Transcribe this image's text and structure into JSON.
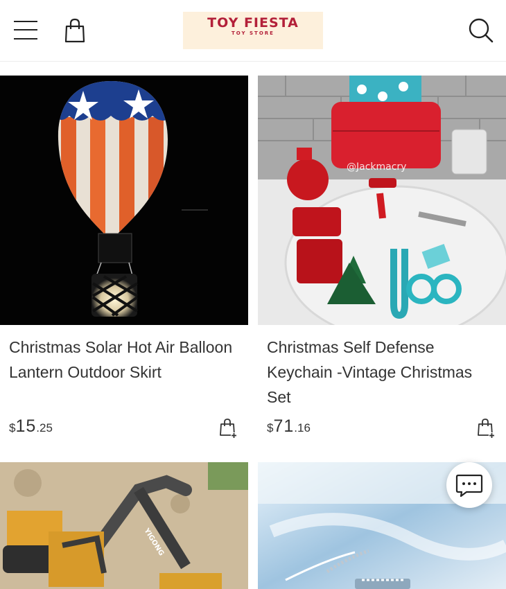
{
  "header": {
    "logo_title": "TOY FIESTA",
    "logo_subtitle": "TOY STORE",
    "menu_icon": "hamburger-menu-icon",
    "cart_icon": "shopping-bag-icon",
    "search_icon": "search-icon",
    "brand_color": "#b32039",
    "logo_bg": "#fdf0dc"
  },
  "products": [
    {
      "title": "Christmas Solar Hot Air Balloon Lantern Outdoor Skirt",
      "price_currency": "$",
      "price_whole": "15",
      "price_decimal": ".25",
      "image": "hot-air-balloon-lantern-photo"
    },
    {
      "title": "Christmas Self Defense Keychain -Vintage Christmas Set",
      "price_currency": "$",
      "price_whole": "71",
      "price_decimal": ".16",
      "image": "self-defense-keychain-set-photo",
      "watermark": "@Jackmacry"
    },
    {
      "image": "toy-excavator-photo",
      "image_text": "YIGONG"
    },
    {
      "image": "bracelet-photo"
    }
  ],
  "chat": {
    "icon": "chat-bubble-icon"
  }
}
